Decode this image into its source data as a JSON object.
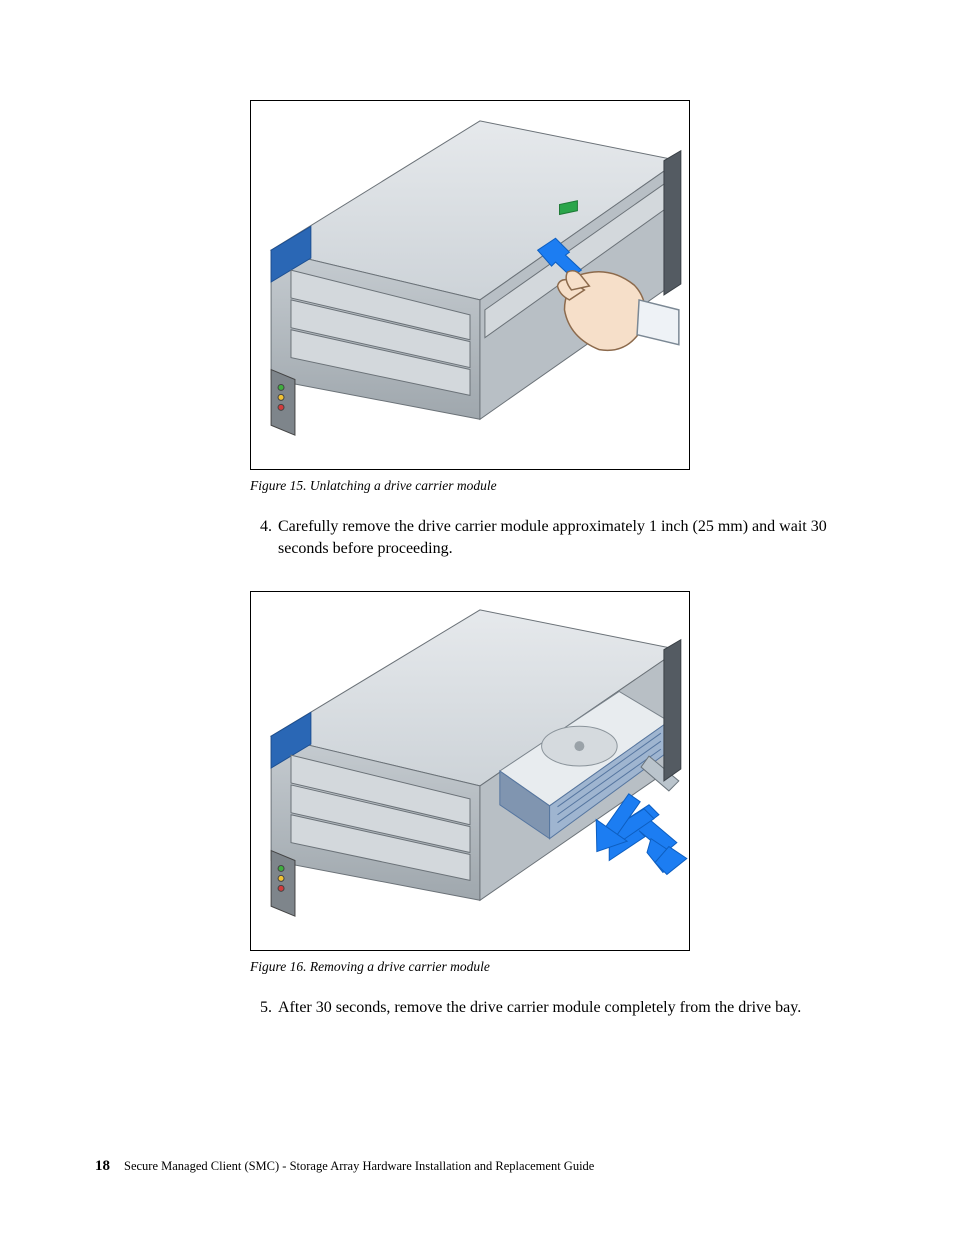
{
  "figures": {
    "fig15": {
      "caption": "Figure 15. Unlatching a drive carrier module"
    },
    "fig16": {
      "caption": "Figure 16. Removing a drive carrier module"
    }
  },
  "steps": {
    "s4": {
      "num": "4.",
      "text": "Carefully remove the drive carrier module approximately 1 inch (25 mm) and wait 30 seconds before proceeding."
    },
    "s5": {
      "num": "5.",
      "text": "After 30 seconds, remove the drive carrier module completely from the drive bay."
    }
  },
  "footer": {
    "page": "18",
    "title": "Secure Managed Client (SMC) - Storage Array Hardware Installation and Replacement Guide"
  }
}
